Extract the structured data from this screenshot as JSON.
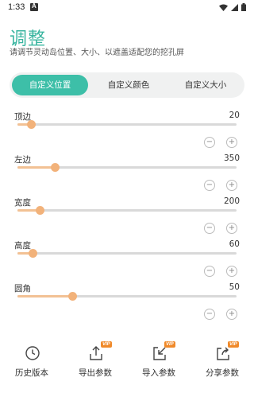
{
  "status": {
    "time": "1:33"
  },
  "header": {
    "title": "调整",
    "subtitle": "请调节灵动岛位置、大小、以遮盖适配您的挖孔屏"
  },
  "tabs": [
    {
      "label": "自定义位置",
      "active": true
    },
    {
      "label": "自定义颜色",
      "active": false
    },
    {
      "label": "自定义大小",
      "active": false
    }
  ],
  "settings": [
    {
      "label": "顶边",
      "value": "20",
      "level": 0.06
    },
    {
      "label": "左边",
      "value": "350",
      "level": 0.17
    },
    {
      "label": "宽度",
      "value": "200",
      "level": 0.1
    },
    {
      "label": "高度",
      "value": "60",
      "level": 0.07
    },
    {
      "label": "圆角",
      "value": "50",
      "level": 0.25
    }
  ],
  "stepper": {
    "minus": "−",
    "plus": "+"
  },
  "actions": [
    {
      "label": "历史版本",
      "icon": "history-icon",
      "vip": false
    },
    {
      "label": "导出参数",
      "icon": "export-icon",
      "vip": true
    },
    {
      "label": "导入参数",
      "icon": "import-icon",
      "vip": true
    },
    {
      "label": "分享参数",
      "icon": "share-icon",
      "vip": true
    }
  ],
  "vip_badge": "VIP",
  "colors": {
    "accent": "#3dbfa8",
    "slider": "#f2b27a",
    "vip": "#f08a2a"
  }
}
